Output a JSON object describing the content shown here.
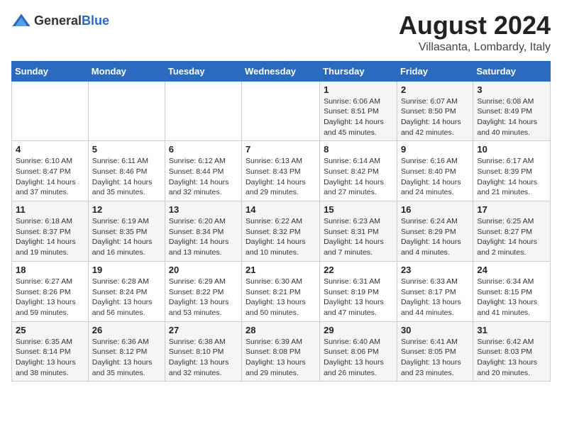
{
  "logo": {
    "general": "General",
    "blue": "Blue"
  },
  "header": {
    "month": "August 2024",
    "location": "Villasanta, Lombardy, Italy"
  },
  "weekdays": [
    "Sunday",
    "Monday",
    "Tuesday",
    "Wednesday",
    "Thursday",
    "Friday",
    "Saturday"
  ],
  "weeks": [
    [
      {
        "day": "",
        "info": ""
      },
      {
        "day": "",
        "info": ""
      },
      {
        "day": "",
        "info": ""
      },
      {
        "day": "",
        "info": ""
      },
      {
        "day": "1",
        "info": "Sunrise: 6:06 AM\nSunset: 8:51 PM\nDaylight: 14 hours\nand 45 minutes."
      },
      {
        "day": "2",
        "info": "Sunrise: 6:07 AM\nSunset: 8:50 PM\nDaylight: 14 hours\nand 42 minutes."
      },
      {
        "day": "3",
        "info": "Sunrise: 6:08 AM\nSunset: 8:49 PM\nDaylight: 14 hours\nand 40 minutes."
      }
    ],
    [
      {
        "day": "4",
        "info": "Sunrise: 6:10 AM\nSunset: 8:47 PM\nDaylight: 14 hours\nand 37 minutes."
      },
      {
        "day": "5",
        "info": "Sunrise: 6:11 AM\nSunset: 8:46 PM\nDaylight: 14 hours\nand 35 minutes."
      },
      {
        "day": "6",
        "info": "Sunrise: 6:12 AM\nSunset: 8:44 PM\nDaylight: 14 hours\nand 32 minutes."
      },
      {
        "day": "7",
        "info": "Sunrise: 6:13 AM\nSunset: 8:43 PM\nDaylight: 14 hours\nand 29 minutes."
      },
      {
        "day": "8",
        "info": "Sunrise: 6:14 AM\nSunset: 8:42 PM\nDaylight: 14 hours\nand 27 minutes."
      },
      {
        "day": "9",
        "info": "Sunrise: 6:16 AM\nSunset: 8:40 PM\nDaylight: 14 hours\nand 24 minutes."
      },
      {
        "day": "10",
        "info": "Sunrise: 6:17 AM\nSunset: 8:39 PM\nDaylight: 14 hours\nand 21 minutes."
      }
    ],
    [
      {
        "day": "11",
        "info": "Sunrise: 6:18 AM\nSunset: 8:37 PM\nDaylight: 14 hours\nand 19 minutes."
      },
      {
        "day": "12",
        "info": "Sunrise: 6:19 AM\nSunset: 8:35 PM\nDaylight: 14 hours\nand 16 minutes."
      },
      {
        "day": "13",
        "info": "Sunrise: 6:20 AM\nSunset: 8:34 PM\nDaylight: 14 hours\nand 13 minutes."
      },
      {
        "day": "14",
        "info": "Sunrise: 6:22 AM\nSunset: 8:32 PM\nDaylight: 14 hours\nand 10 minutes."
      },
      {
        "day": "15",
        "info": "Sunrise: 6:23 AM\nSunset: 8:31 PM\nDaylight: 14 hours\nand 7 minutes."
      },
      {
        "day": "16",
        "info": "Sunrise: 6:24 AM\nSunset: 8:29 PM\nDaylight: 14 hours\nand 4 minutes."
      },
      {
        "day": "17",
        "info": "Sunrise: 6:25 AM\nSunset: 8:27 PM\nDaylight: 14 hours\nand 2 minutes."
      }
    ],
    [
      {
        "day": "18",
        "info": "Sunrise: 6:27 AM\nSunset: 8:26 PM\nDaylight: 13 hours\nand 59 minutes."
      },
      {
        "day": "19",
        "info": "Sunrise: 6:28 AM\nSunset: 8:24 PM\nDaylight: 13 hours\nand 56 minutes."
      },
      {
        "day": "20",
        "info": "Sunrise: 6:29 AM\nSunset: 8:22 PM\nDaylight: 13 hours\nand 53 minutes."
      },
      {
        "day": "21",
        "info": "Sunrise: 6:30 AM\nSunset: 8:21 PM\nDaylight: 13 hours\nand 50 minutes."
      },
      {
        "day": "22",
        "info": "Sunrise: 6:31 AM\nSunset: 8:19 PM\nDaylight: 13 hours\nand 47 minutes."
      },
      {
        "day": "23",
        "info": "Sunrise: 6:33 AM\nSunset: 8:17 PM\nDaylight: 13 hours\nand 44 minutes."
      },
      {
        "day": "24",
        "info": "Sunrise: 6:34 AM\nSunset: 8:15 PM\nDaylight: 13 hours\nand 41 minutes."
      }
    ],
    [
      {
        "day": "25",
        "info": "Sunrise: 6:35 AM\nSunset: 8:14 PM\nDaylight: 13 hours\nand 38 minutes."
      },
      {
        "day": "26",
        "info": "Sunrise: 6:36 AM\nSunset: 8:12 PM\nDaylight: 13 hours\nand 35 minutes."
      },
      {
        "day": "27",
        "info": "Sunrise: 6:38 AM\nSunset: 8:10 PM\nDaylight: 13 hours\nand 32 minutes."
      },
      {
        "day": "28",
        "info": "Sunrise: 6:39 AM\nSunset: 8:08 PM\nDaylight: 13 hours\nand 29 minutes."
      },
      {
        "day": "29",
        "info": "Sunrise: 6:40 AM\nSunset: 8:06 PM\nDaylight: 13 hours\nand 26 minutes."
      },
      {
        "day": "30",
        "info": "Sunrise: 6:41 AM\nSunset: 8:05 PM\nDaylight: 13 hours\nand 23 minutes."
      },
      {
        "day": "31",
        "info": "Sunrise: 6:42 AM\nSunset: 8:03 PM\nDaylight: 13 hours\nand 20 minutes."
      }
    ]
  ]
}
